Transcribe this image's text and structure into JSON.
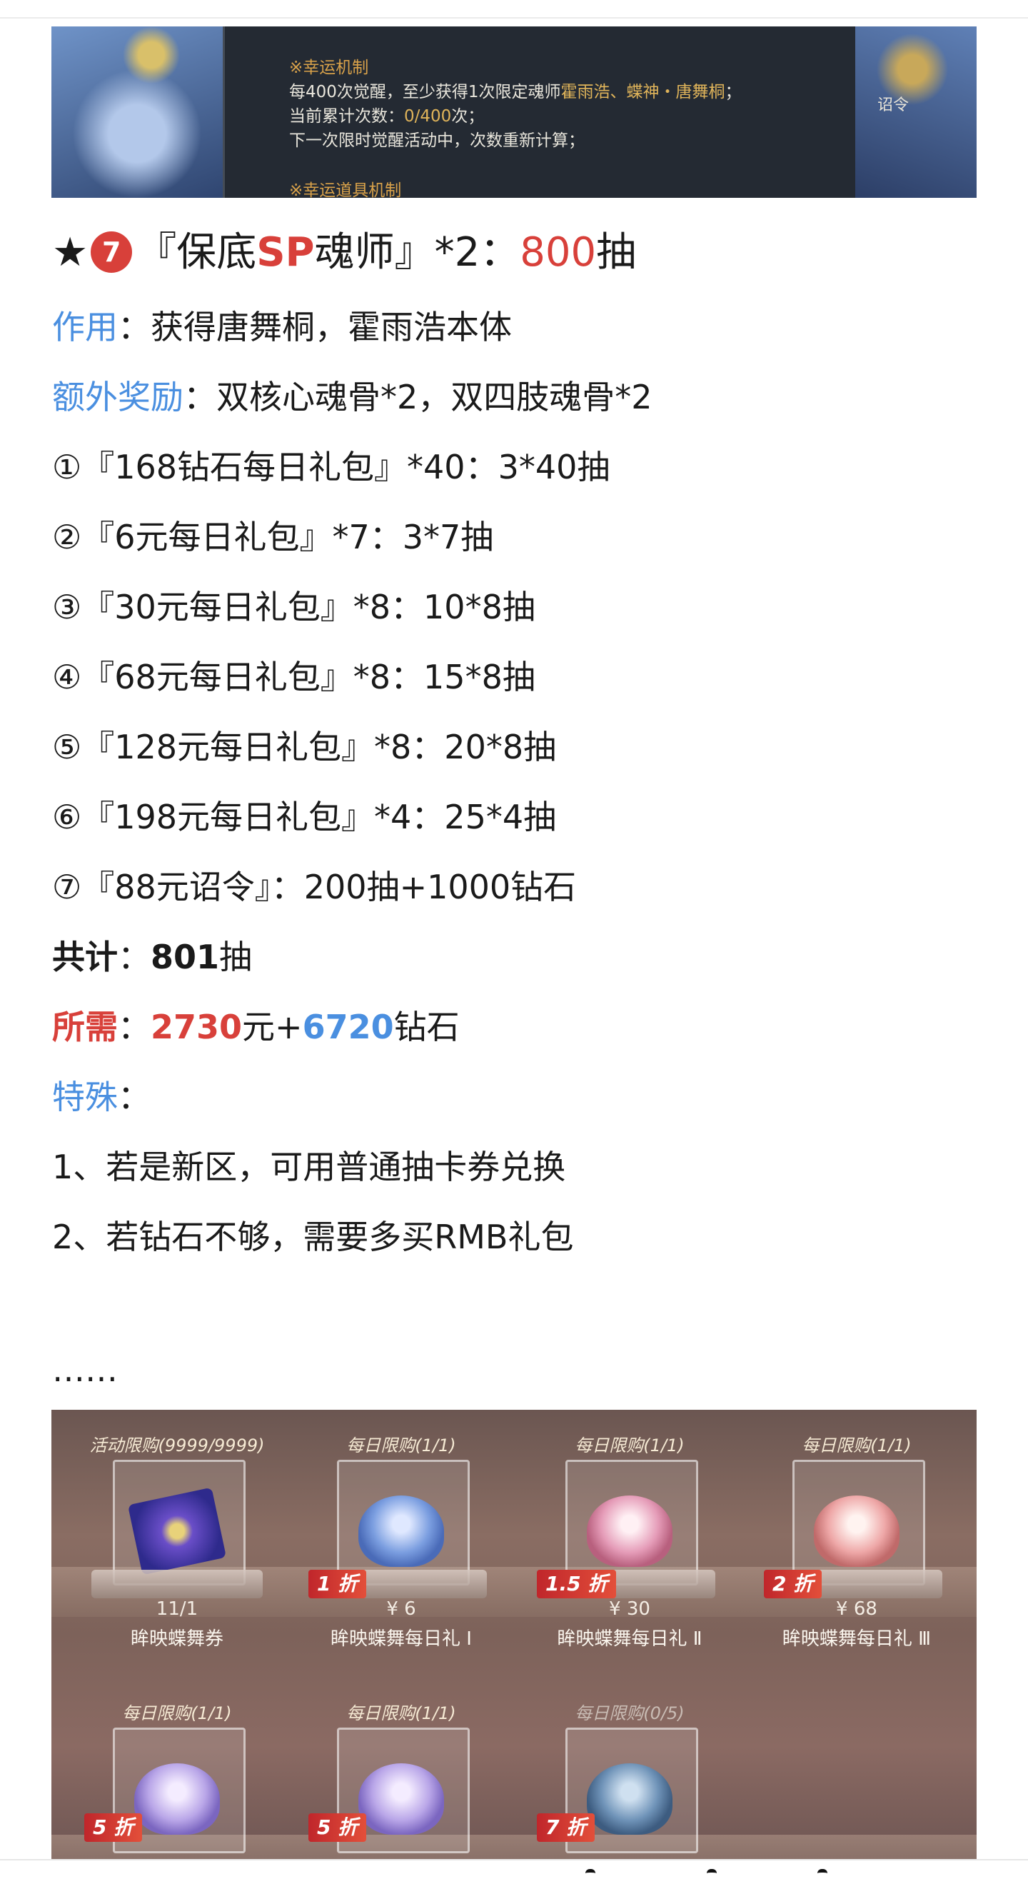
{
  "top_screenshot": {
    "heading_1": "※幸运机制",
    "line_1_pre": "每400次觉醒，至少获得1次限定魂师",
    "line_1_hl": "霍雨浩、蝶神・唐舞桐",
    "line_1_post": "；",
    "line_2_pre": "当前累计次数：",
    "line_2_hl": "0/400",
    "line_2_post": "次；",
    "line_3": "下一次限时觉醒活动中，次数重新计算；",
    "heading_2": "※幸运道具机制",
    "side_label": "诏令"
  },
  "article": {
    "title": {
      "star": "★",
      "badge": "7",
      "open": "『保底",
      "sp": "SP",
      "close": "魂师』*2：",
      "count": "800",
      "unit": "抽"
    },
    "effect_label": "作用",
    "effect_text": "：获得唐舞桐，霍雨浩本体",
    "bonus_label": "额外奖励",
    "bonus_text": "：双核心魂骨*2，双四肢魂骨*2",
    "items": [
      "①『168钻石每日礼包』*40：3*40抽",
      "②『6元每日礼包』*7：3*7抽",
      "③『30元每日礼包』*8：10*8抽",
      "④『68元每日礼包』*8：15*8抽",
      "⑤『128元每日礼包』*8：20*8抽",
      "⑥『198元每日礼包』*4：25*4抽",
      "⑦『88元诏令』：200抽+1000钻石"
    ],
    "total_label": "共计",
    "total_sep": "：",
    "total_value": "801",
    "total_unit": "抽",
    "need_label": "所需",
    "need_sep": "：",
    "need_yuan": "2730",
    "need_yuan_unit": "元+",
    "need_diamond": "6720",
    "need_diamond_unit": "钻石",
    "special_label": "特殊",
    "special_sep": "：",
    "special_1": "1、若是新区，可用普通抽卡券兑换",
    "special_2": "2、若钻石不够，需要多买RMB礼包",
    "ellipsis": "……"
  },
  "shop": {
    "row1": [
      {
        "limit": "活动限购(9999/9999)",
        "price": "11/1",
        "name": "眸映蝶舞券",
        "tag": ""
      },
      {
        "limit": "每日限购(1/1)",
        "price": "¥ 6",
        "name": "眸映蝶舞每日礼 Ⅰ",
        "tag": "1 折"
      },
      {
        "limit": "每日限购(1/1)",
        "price": "¥ 30",
        "name": "眸映蝶舞每日礼 Ⅱ",
        "tag": "1.5 折"
      },
      {
        "limit": "每日限购(1/1)",
        "price": "¥ 68",
        "name": "眸映蝶舞每日礼 Ⅲ",
        "tag": "2 折"
      }
    ],
    "row2": [
      {
        "limit": "每日限购(1/1)",
        "tag": "5 折"
      },
      {
        "limit": "每日限购(1/1)",
        "tag": "5 折"
      },
      {
        "limit": "每日限购(0/5)",
        "tag": "7 折"
      }
    ]
  },
  "colors": {
    "red": "#d8403a",
    "blue": "#4a8fe0"
  }
}
